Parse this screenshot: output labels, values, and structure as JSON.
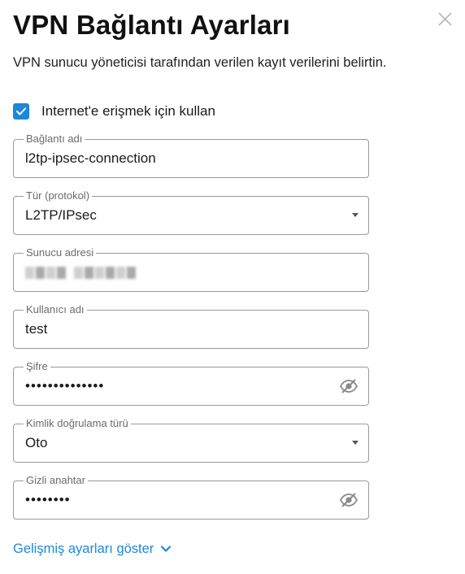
{
  "dialog": {
    "title": "VPN Bağlantı Ayarları",
    "subtitle": "VPN sunucu yöneticisi tarafından verilen kayıt verilerini belirtin.",
    "close_icon": "close-icon"
  },
  "internet_checkbox": {
    "label": "Internet'e erişmek için kullan",
    "checked": true
  },
  "fields": {
    "connection_name": {
      "label": "Bağlantı adı",
      "value": "l2tp-ipsec-connection"
    },
    "protocol": {
      "label": "Tür (protokol)",
      "value": "L2TP/IPsec"
    },
    "server_address": {
      "label": "Sunucu adresi",
      "value_redacted": true
    },
    "username": {
      "label": "Kullanıcı adı",
      "value": "test"
    },
    "password": {
      "label": "Şifre",
      "value": "••••••••••••••"
    },
    "auth_type": {
      "label": "Kimlik doğrulama türü",
      "value": "Oto"
    },
    "secret_key": {
      "label": "Gizli anahtar",
      "value": "••••••••"
    }
  },
  "advanced_link": {
    "label": "Gelişmiş ayarları göster",
    "icon": "chevron-down-icon"
  },
  "colors": {
    "accent": "#1e88d8",
    "border": "#9a9a9a",
    "label": "#6b6b6b"
  }
}
